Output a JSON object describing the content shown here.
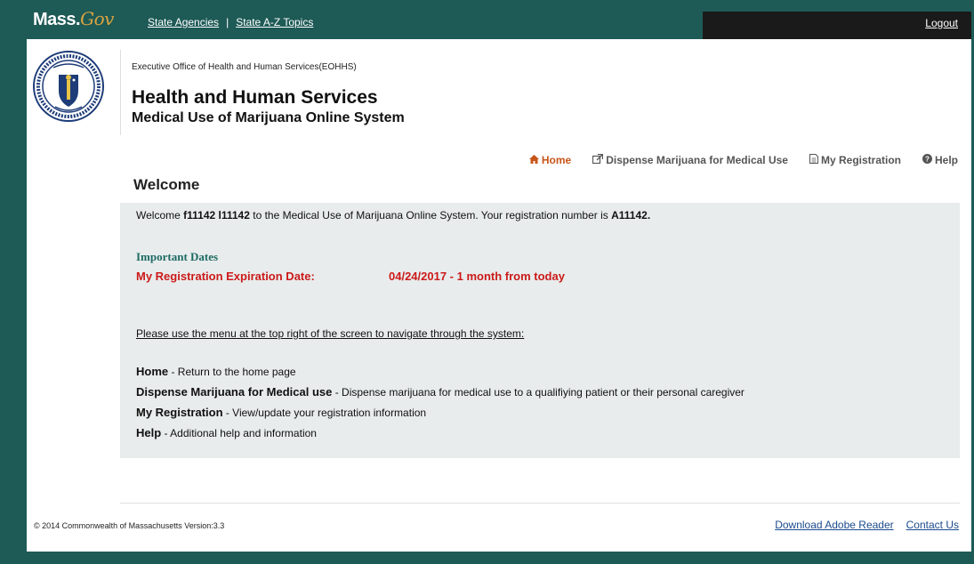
{
  "header": {
    "logo_main": "Mass.",
    "logo_gov": "Gov",
    "links": [
      "State Agencies",
      "State A-Z Topics"
    ],
    "logout": "Logout"
  },
  "agency": {
    "office": "Executive Office of Health and Human Services(EOHHS)",
    "title": "Health and Human Services",
    "subtitle": "Medical Use of Marijuana Online System"
  },
  "nav": {
    "items": [
      {
        "label": "Home",
        "icon": "home-icon",
        "active": true
      },
      {
        "label": "Dispense Marijuana for Medical Use",
        "icon": "external-link-icon"
      },
      {
        "label": "My Registration",
        "icon": "document-icon"
      },
      {
        "label": "Help",
        "icon": "help-icon"
      }
    ]
  },
  "page": {
    "heading": "Welcome",
    "welcome_prefix": "Welcome ",
    "user_name": "f11142 l11142",
    "welcome_middle": " to the Medical Use of Marijuana Online System. Your registration number is ",
    "registration_number": "A11142.",
    "important_dates_title": "Important Dates",
    "expiration_label": "My Registration Expiration Date:",
    "expiration_value": "04/24/2017 - 1 month from today",
    "instruction": "Please use the menu at the top right of the screen to navigate through the system:",
    "menu_help": [
      {
        "term": "Home",
        "desc": " - Return to the home page"
      },
      {
        "term": "Dispense Marijuana for Medical use",
        "desc": " - Dispense marijuana for medical use to a qualifiying patient or their personal caregiver"
      },
      {
        "term": "My Registration",
        "desc": " - View/update your registration information"
      },
      {
        "term": "Help",
        "desc": " - Additional help and information"
      }
    ]
  },
  "footer": {
    "copyright": "© 2014 Commonwealth of Massachusetts Version:3.3",
    "links": [
      "Download Adobe Reader",
      "Contact Us"
    ]
  },
  "colors": {
    "brand_teal": "#1e5a56",
    "accent_orange": "#c8551a",
    "alert_red": "#cc1a1a",
    "content_bg": "#e8ecec"
  }
}
